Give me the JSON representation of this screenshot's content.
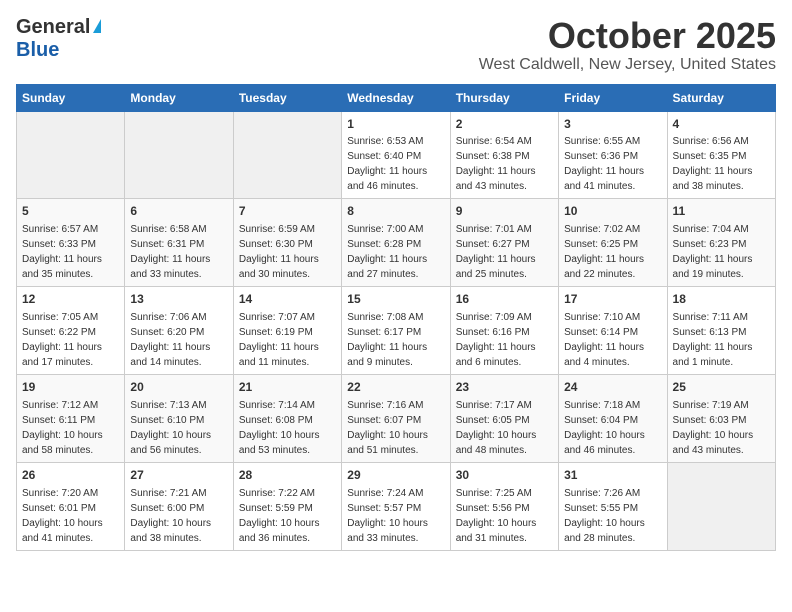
{
  "logo": {
    "line1": "General",
    "line2": "Blue"
  },
  "title": "October 2025",
  "location": "West Caldwell, New Jersey, United States",
  "weekdays": [
    "Sunday",
    "Monday",
    "Tuesday",
    "Wednesday",
    "Thursday",
    "Friday",
    "Saturday"
  ],
  "weeks": [
    [
      {
        "day": "",
        "info": ""
      },
      {
        "day": "",
        "info": ""
      },
      {
        "day": "",
        "info": ""
      },
      {
        "day": "1",
        "info": "Sunrise: 6:53 AM\nSunset: 6:40 PM\nDaylight: 11 hours and 46 minutes."
      },
      {
        "day": "2",
        "info": "Sunrise: 6:54 AM\nSunset: 6:38 PM\nDaylight: 11 hours and 43 minutes."
      },
      {
        "day": "3",
        "info": "Sunrise: 6:55 AM\nSunset: 6:36 PM\nDaylight: 11 hours and 41 minutes."
      },
      {
        "day": "4",
        "info": "Sunrise: 6:56 AM\nSunset: 6:35 PM\nDaylight: 11 hours and 38 minutes."
      }
    ],
    [
      {
        "day": "5",
        "info": "Sunrise: 6:57 AM\nSunset: 6:33 PM\nDaylight: 11 hours and 35 minutes."
      },
      {
        "day": "6",
        "info": "Sunrise: 6:58 AM\nSunset: 6:31 PM\nDaylight: 11 hours and 33 minutes."
      },
      {
        "day": "7",
        "info": "Sunrise: 6:59 AM\nSunset: 6:30 PM\nDaylight: 11 hours and 30 minutes."
      },
      {
        "day": "8",
        "info": "Sunrise: 7:00 AM\nSunset: 6:28 PM\nDaylight: 11 hours and 27 minutes."
      },
      {
        "day": "9",
        "info": "Sunrise: 7:01 AM\nSunset: 6:27 PM\nDaylight: 11 hours and 25 minutes."
      },
      {
        "day": "10",
        "info": "Sunrise: 7:02 AM\nSunset: 6:25 PM\nDaylight: 11 hours and 22 minutes."
      },
      {
        "day": "11",
        "info": "Sunrise: 7:04 AM\nSunset: 6:23 PM\nDaylight: 11 hours and 19 minutes."
      }
    ],
    [
      {
        "day": "12",
        "info": "Sunrise: 7:05 AM\nSunset: 6:22 PM\nDaylight: 11 hours and 17 minutes."
      },
      {
        "day": "13",
        "info": "Sunrise: 7:06 AM\nSunset: 6:20 PM\nDaylight: 11 hours and 14 minutes."
      },
      {
        "day": "14",
        "info": "Sunrise: 7:07 AM\nSunset: 6:19 PM\nDaylight: 11 hours and 11 minutes."
      },
      {
        "day": "15",
        "info": "Sunrise: 7:08 AM\nSunset: 6:17 PM\nDaylight: 11 hours and 9 minutes."
      },
      {
        "day": "16",
        "info": "Sunrise: 7:09 AM\nSunset: 6:16 PM\nDaylight: 11 hours and 6 minutes."
      },
      {
        "day": "17",
        "info": "Sunrise: 7:10 AM\nSunset: 6:14 PM\nDaylight: 11 hours and 4 minutes."
      },
      {
        "day": "18",
        "info": "Sunrise: 7:11 AM\nSunset: 6:13 PM\nDaylight: 11 hours and 1 minute."
      }
    ],
    [
      {
        "day": "19",
        "info": "Sunrise: 7:12 AM\nSunset: 6:11 PM\nDaylight: 10 hours and 58 minutes."
      },
      {
        "day": "20",
        "info": "Sunrise: 7:13 AM\nSunset: 6:10 PM\nDaylight: 10 hours and 56 minutes."
      },
      {
        "day": "21",
        "info": "Sunrise: 7:14 AM\nSunset: 6:08 PM\nDaylight: 10 hours and 53 minutes."
      },
      {
        "day": "22",
        "info": "Sunrise: 7:16 AM\nSunset: 6:07 PM\nDaylight: 10 hours and 51 minutes."
      },
      {
        "day": "23",
        "info": "Sunrise: 7:17 AM\nSunset: 6:05 PM\nDaylight: 10 hours and 48 minutes."
      },
      {
        "day": "24",
        "info": "Sunrise: 7:18 AM\nSunset: 6:04 PM\nDaylight: 10 hours and 46 minutes."
      },
      {
        "day": "25",
        "info": "Sunrise: 7:19 AM\nSunset: 6:03 PM\nDaylight: 10 hours and 43 minutes."
      }
    ],
    [
      {
        "day": "26",
        "info": "Sunrise: 7:20 AM\nSunset: 6:01 PM\nDaylight: 10 hours and 41 minutes."
      },
      {
        "day": "27",
        "info": "Sunrise: 7:21 AM\nSunset: 6:00 PM\nDaylight: 10 hours and 38 minutes."
      },
      {
        "day": "28",
        "info": "Sunrise: 7:22 AM\nSunset: 5:59 PM\nDaylight: 10 hours and 36 minutes."
      },
      {
        "day": "29",
        "info": "Sunrise: 7:24 AM\nSunset: 5:57 PM\nDaylight: 10 hours and 33 minutes."
      },
      {
        "day": "30",
        "info": "Sunrise: 7:25 AM\nSunset: 5:56 PM\nDaylight: 10 hours and 31 minutes."
      },
      {
        "day": "31",
        "info": "Sunrise: 7:26 AM\nSunset: 5:55 PM\nDaylight: 10 hours and 28 minutes."
      },
      {
        "day": "",
        "info": ""
      }
    ]
  ]
}
